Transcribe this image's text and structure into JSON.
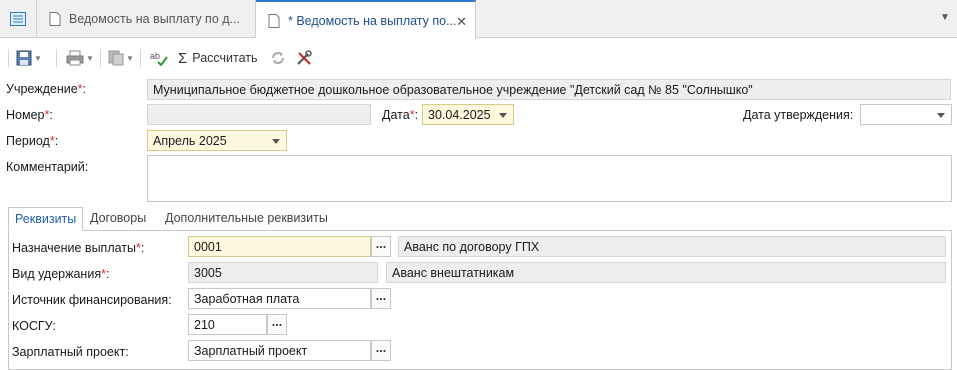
{
  "tabs": [
    {
      "label": "Ведомость на выплату по д..."
    },
    {
      "label": "* Ведомость на выплату по..."
    }
  ],
  "toolbar": {
    "calculate_label": "Рассчитать"
  },
  "form": {
    "institution_label": "Учреждение",
    "institution_value": "Муниципальное бюджетное дошкольное образовательное учреждение \"Детский сад № 85 \"Солнышко\"",
    "number_label": "Номер",
    "number_value": "",
    "date_label": "Дата",
    "date_value": "30.04.2025",
    "approval_date_label": "Дата утверждения:",
    "approval_date_value": "",
    "period_label": "Период",
    "period_value": "Апрель 2025",
    "comment_label": "Комментарий:",
    "comment_value": ""
  },
  "inner_tabs": [
    "Реквизиты",
    "Договоры",
    "Дополнительные реквизиты"
  ],
  "requisites": {
    "payment_purpose_label": "Назначение выплаты",
    "payment_purpose_code": "0001",
    "payment_purpose_name": "Аванс по договору ГПХ",
    "deduction_type_label": "Вид удержания",
    "deduction_type_code": "3005",
    "deduction_type_name": "Аванс внештатникам",
    "funding_source_label": "Источник финансирования:",
    "funding_source_value": "Заработная плата",
    "kosgu_label": "КОСГУ:",
    "kosgu_value": "210",
    "salary_project_label": "Зарплатный проект:",
    "salary_project_value": "Зарплатный проект"
  },
  "colors": {
    "accent": "#2b79c9",
    "required_marker": "#e03030",
    "highlight_field": "#fff9e0",
    "readonly_field": "#eeeeee"
  }
}
